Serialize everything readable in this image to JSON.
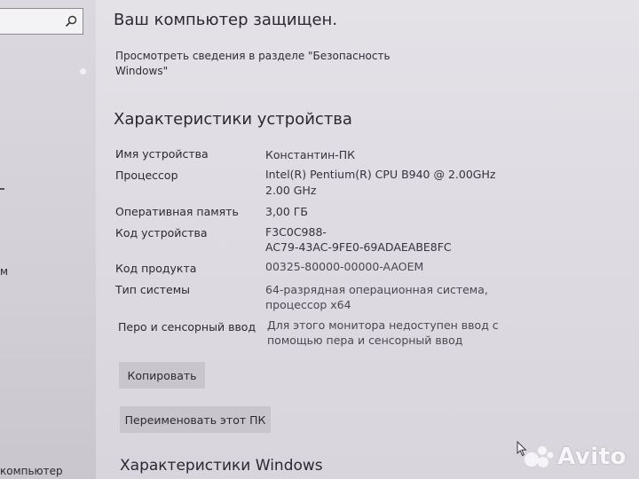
{
  "sidebar": {
    "search_placeholder": "",
    "partial_item_1": "м",
    "partial_item_2": "компьютер"
  },
  "security": {
    "title": "Ваш компьютер защищен.",
    "link_line_1": "Просмотреть сведения в разделе \"Безопасность",
    "link_line_2": "Windows\""
  },
  "device_specs": {
    "title": "Характеристики устройства",
    "rows": [
      {
        "label": "Имя устройства",
        "value_lines": [
          "Константин-ПК"
        ]
      },
      {
        "label": "Процессор",
        "value_lines": [
          "Intel(R) Pentium(R) CPU B940 @ 2.00GHz",
          "2.00 GHz"
        ]
      },
      {
        "label": "Оперативная память",
        "value_lines": [
          "3,00 ГБ"
        ]
      },
      {
        "label": "Код устройства",
        "value_lines": [
          "F3C0C988-",
          "AC79-43AC-9FE0-69ADAEABE8FC"
        ]
      },
      {
        "label": "Код продукта",
        "value_lines": [
          "00325-80000-00000-AAOEM"
        ]
      },
      {
        "label": "Тип системы",
        "value_lines": [
          "64-разрядная операционная система,",
          "процессор x64"
        ]
      },
      {
        "label": "Перо и сенсорный ввод",
        "value_lines": [
          "Для этого монитора недоступен ввод с",
          "помощью пера и сенсорный ввод"
        ]
      }
    ],
    "copy_button": "Копировать",
    "rename_button": "Переименовать этот ПК"
  },
  "windows_specs": {
    "title": "Характеристики Windows"
  },
  "watermark": {
    "text": "Avito"
  },
  "icons": [
    "search-icon",
    "mouse-cursor-icon",
    "avito-logo-icon"
  ]
}
